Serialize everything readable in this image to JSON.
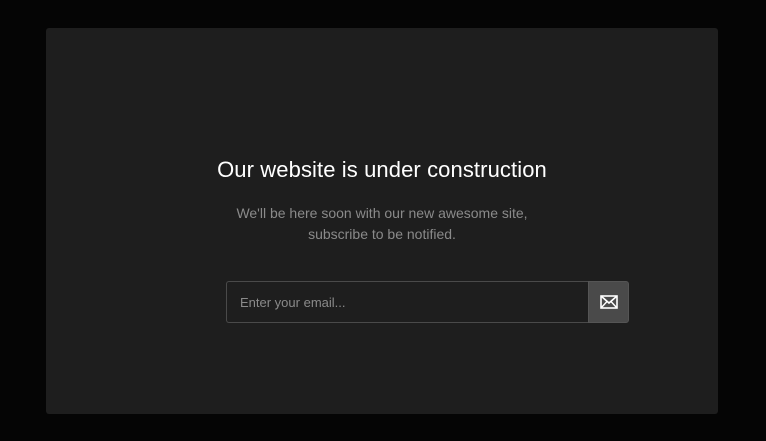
{
  "page": {
    "title": "Our website is under construction",
    "subtitle_lines": [
      "We'll be here soon with our new awesome site,",
      "subscribe to be notified."
    ]
  },
  "subscribe_form": {
    "email_placeholder": "Enter your email...",
    "email_value": "",
    "submit_icon": "envelope-icon"
  },
  "colors": {
    "page_background": "#050505",
    "card_background": "#1e1e1e",
    "title_text": "#ffffff",
    "subtitle_text": "#8a8a8a",
    "button_background": "#4a4a4a"
  }
}
